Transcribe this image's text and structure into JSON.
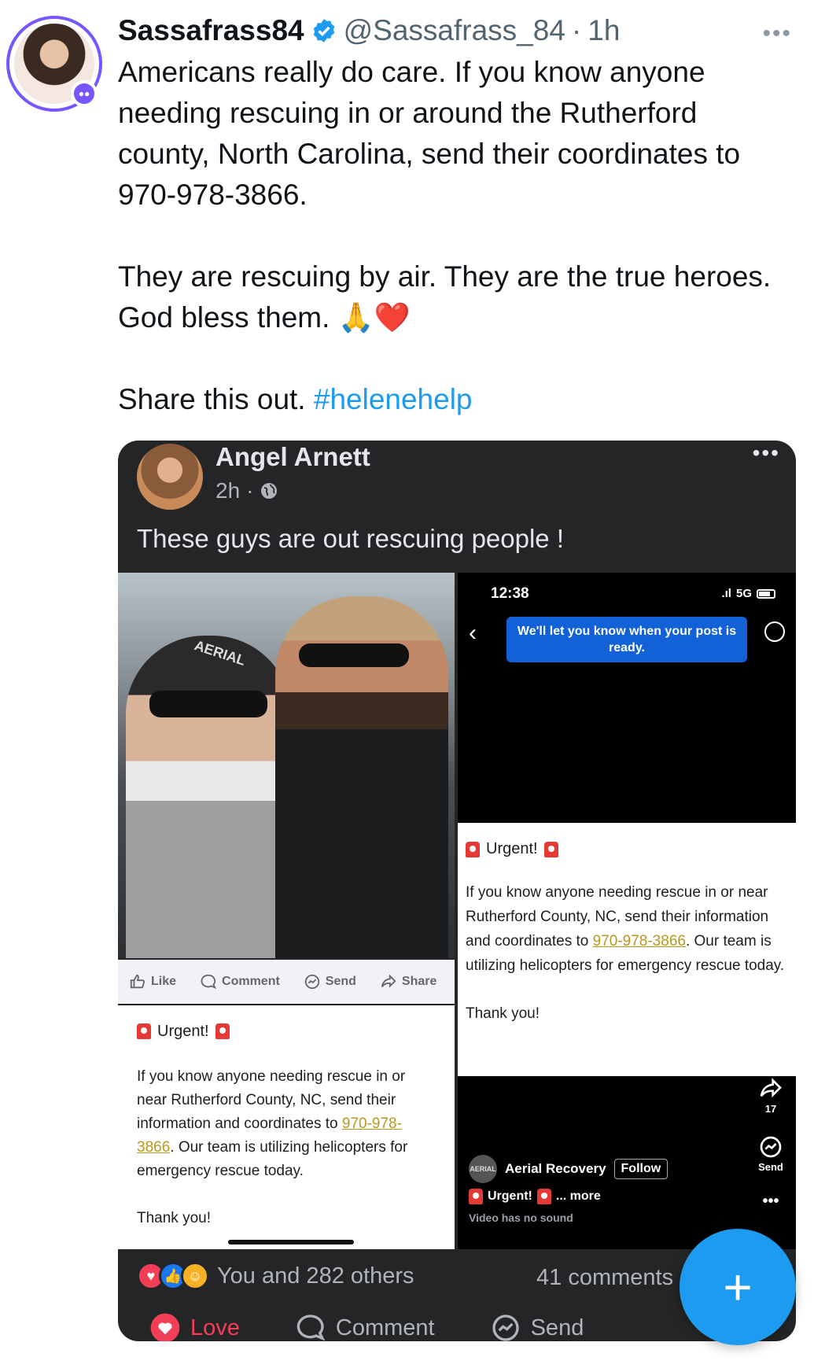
{
  "tweet": {
    "display_name": "Sassafrass84",
    "handle": "@Sassafrass_84",
    "separator": "·",
    "time": "1h",
    "paragraph1": "Americans really do care. If you know anyone needing rescuing in or around the Rutherford county, North Carolina, send their coordinates to 970-978-3866.",
    "paragraph2": "They are rescuing by air. They are the true heroes. God bless them. 🙏❤️",
    "paragraph3_text": "Share this out. ",
    "hashtag": "#helenehelp",
    "colors": {
      "accent": "#1d9bf0",
      "verified": "#1d9bf0",
      "avatar_ring": "#7856ff"
    }
  },
  "embedded_post": {
    "author": "Angel Arnett",
    "time": "2h",
    "meta_sep": "·",
    "caption": "These guys are out rescuing people !",
    "photo_label": "AERIAL",
    "action_bar": {
      "like": "Like",
      "comment": "Comment",
      "send": "Send",
      "share": "Share"
    },
    "urgent_title": "Urgent!",
    "urgent_body_before": "If you know anyone needing rescue in or near Rutherford County, NC, send their information and coordinates to ",
    "urgent_phone": "970-978-3866",
    "urgent_body_after": ". Our team is utilizing helicopters for emergency rescue today.",
    "urgent_thanks": "Thank you!",
    "phone_screen": {
      "time": "12:38",
      "network": "5G",
      "toast": "We'll let you know when your post is ready.",
      "share_count": "17",
      "send_label": "Send",
      "author": "Aerial Recovery",
      "author_avatar_text": "AERIAL",
      "follow_label": "Follow",
      "urgent_line": "Urgent!",
      "more_label": "... more",
      "no_sound": "Video has no sound"
    },
    "reactions_text": "You and 282 others",
    "comments_count": "41 comments",
    "bottom_actions": {
      "love": "Love",
      "comment": "Comment",
      "send": "Send"
    }
  },
  "fab": {
    "label": "+",
    "color": "#1d9bf0"
  }
}
